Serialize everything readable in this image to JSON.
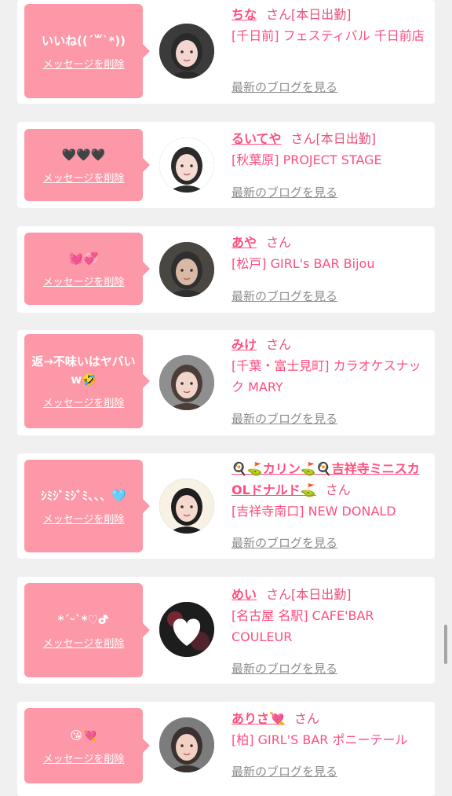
{
  "colors": {
    "bubble": "#fd98a8",
    "accent": "#ff4d7e",
    "background": "#f0f0f0",
    "link_gray": "#8c8c8c"
  },
  "labels": {
    "delete_message": "メッセージを削除",
    "see_blog": "最新のブログを見る",
    "san": "さん"
  },
  "entries": [
    {
      "message": "いいね((ˊ꒳ˋ*))",
      "name": "ちな",
      "status": "[本日出勤]",
      "shop": "[千日前] フェスティバル 千日前店",
      "avatar_icon": "girl-avatar-icon"
    },
    {
      "message": "🖤🖤🖤",
      "name": "るいてや",
      "status": "[本日出勤]",
      "shop": "[秋葉原] PROJECT STAGE",
      "avatar_icon": "girl-avatar-icon"
    },
    {
      "message": "💓💞",
      "name": "あや",
      "status": "",
      "shop": "[松戸] GIRL's BAR Bijou",
      "avatar_icon": "girl-avatar-icon"
    },
    {
      "message": "返→不味いはヤバいw🤣",
      "name": "みけ",
      "status": "",
      "shop": "[千葉・富士見町] カラオケスナック MARY",
      "avatar_icon": "girl-avatar-icon"
    },
    {
      "message": "ｼﾐｼﾞﾐｼﾞﾐ、、、🩵",
      "name": "🍳⛳カリン⛳🍳吉祥寺ミニスカOLドナルド⛳",
      "status": "",
      "shop": "[吉祥寺南口] NEW DONALD",
      "avatar_icon": "girl-avatar-icon"
    },
    {
      "message": "*ˊᵕˋ*♡ᕷ",
      "name": "めい",
      "status": "[本日出勤]",
      "shop": "[名古屋 名駅] CAFE'BAR COULEUR",
      "avatar_icon": "heart-avatar-icon"
    },
    {
      "message": "😘💘",
      "name": "ありさ💘",
      "status": "",
      "shop": "[柏] GIRL'S BAR ポニーテール",
      "avatar_icon": "girl-avatar-icon"
    }
  ]
}
